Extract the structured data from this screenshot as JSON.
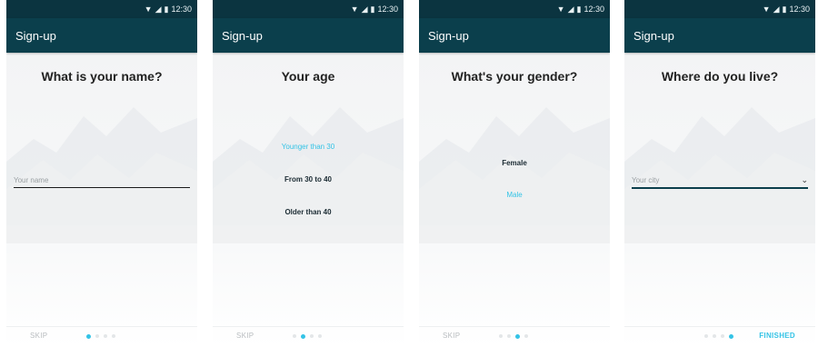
{
  "status": {
    "time": "12:30"
  },
  "screens": [
    {
      "app_title": "Sign-up",
      "question": "What is your name?",
      "input": {
        "placeholder": "Your name",
        "value": ""
      },
      "footer": {
        "skip": "SKIP",
        "finished": "",
        "active_step": 0
      }
    },
    {
      "app_title": "Sign-up",
      "question": "Your age",
      "options": [
        {
          "label": "Younger than 30",
          "selected": true
        },
        {
          "label": "From 30 to 40",
          "selected": false
        },
        {
          "label": "Older than 40",
          "selected": false
        }
      ],
      "footer": {
        "skip": "SKIP",
        "finished": "",
        "active_step": 1
      }
    },
    {
      "app_title": "Sign-up",
      "question": "What's your gender?",
      "options": [
        {
          "label": "Female",
          "selected": false
        },
        {
          "label": "Male",
          "selected": true
        }
      ],
      "footer": {
        "skip": "SKIP",
        "finished": "",
        "active_step": 2
      }
    },
    {
      "app_title": "Sign-up",
      "question": "Where do you live?",
      "select": {
        "placeholder": "Your city"
      },
      "footer": {
        "skip": "",
        "finished": "FINISHED",
        "active_step": 3
      }
    }
  ],
  "colors": {
    "app_bar": "#0b3f4c",
    "status_bar": "#0b3440",
    "accent": "#34c3e6"
  },
  "icons": [
    "wifi-icon",
    "signal-icon",
    "battery-icon",
    "chevron-down-icon"
  ]
}
